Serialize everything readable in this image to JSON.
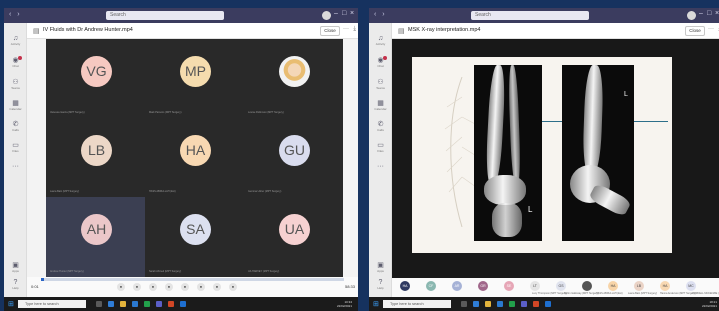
{
  "common": {
    "search_placeholder": "Search",
    "nav_arrows": "‹ ›",
    "window_controls": {
      "more": "···",
      "minimize": "–",
      "restore": "□",
      "close": "×"
    },
    "rail": [
      {
        "icon": "activity-icon",
        "label": "Activity"
      },
      {
        "icon": "chat-icon",
        "label": "Chat"
      },
      {
        "icon": "teams-icon",
        "label": "Teams"
      },
      {
        "icon": "calendar-icon",
        "label": "Calendar"
      },
      {
        "icon": "calls-icon",
        "label": "Calls"
      },
      {
        "icon": "files-icon",
        "label": "Files"
      }
    ],
    "rail_bottom": [
      {
        "label": "Apps"
      },
      {
        "label": "Help"
      }
    ],
    "close_label": "Close",
    "taskbar": {
      "search_placeholder": "Type here to search"
    },
    "colors": {
      "titlebar": "#3b3c5f",
      "accent": "#2a64c5",
      "taskbar": "#1b1b1b"
    }
  },
  "left": {
    "file_title": "IV Fluids with Dr Andrew Hunter.mp4",
    "tiles": [
      {
        "initials": "VG",
        "color": "#f6c9c1",
        "name": "Vanessa Garcia (MPT Surgery)"
      },
      {
        "initials": "MP",
        "color": "#f5dcae",
        "name": "Mark Parsons (MPT Surgery)"
      },
      {
        "initials": "",
        "photo": true,
        "name": "Louise Robinson (MPT Surgery)"
      },
      {
        "initials": "LB",
        "color": "#ecd7c7",
        "name": "Laura Bain (MPT Surgery)"
      },
      {
        "initials": "HA",
        "color": "#f8d8b2",
        "name": "HASS ABDULLAH (Ext)"
      },
      {
        "initials": "GU",
        "color": "#d9dcee",
        "name": "Gemma Usher (MPT Surgery)"
      },
      {
        "initials": "AH",
        "color": "#ebc7c9",
        "name": "Andrew Hunter (MPT Surgery)",
        "selected": true
      },
      {
        "initials": "SA",
        "color": "#dce0f0",
        "name": "Sarah Ahmed (MPT Surgery)"
      },
      {
        "initials": "UA",
        "color": "#f6d1d1",
        "name": "UA HARVEY (MPT Surgery)"
      }
    ],
    "playback": {
      "current": "0:01",
      "total": "58:33",
      "progress": 0.01
    },
    "controls": [
      "Play",
      "Back",
      "Fwd",
      "Vol",
      "Captions",
      "Speed",
      "Settings",
      "Full"
    ],
    "clock": {
      "time": "10:34",
      "date": "22/02/2021"
    }
  },
  "right": {
    "file_title": "MSK X-ray interpretation.mp4",
    "xray_marker": "L",
    "participants": [
      {
        "initials": "HA",
        "color": "#2f3a61",
        "text": "#fff"
      },
      {
        "initials": "CF",
        "color": "#8ab7b0",
        "text": "#fff"
      },
      {
        "initials": "AR",
        "color": "#a6b2d6",
        "text": "#fff"
      },
      {
        "initials": "GR",
        "color": "#a0678a",
        "text": "#fff"
      },
      {
        "initials": "SE",
        "color": "#e6a6b6",
        "text": "#fff"
      },
      {
        "initials": "LT",
        "color": "#e5e5e5",
        "text": "#444"
      },
      {
        "initials": "GS",
        "color": "#e0e3ee",
        "text": "#444"
      },
      {
        "initials": "",
        "color": "#555555",
        "text": "#fff"
      },
      {
        "initials": "HA",
        "color": "#f7d4a8",
        "text": "#444"
      },
      {
        "initials": "LB",
        "color": "#ead3c6",
        "text": "#444"
      },
      {
        "initials": "HA",
        "color": "#f8d8b2",
        "text": "#444"
      },
      {
        "initials": "MC",
        "color": "#dcdff0",
        "text": "#444"
      }
    ],
    "participant_captions": [
      "Lucy Thompson (MPT Surgery)",
      "Rubin Galloway (MPT Surgery)",
      "HASS ABDULLAH (Ext)",
      "Laura Bain (MPT Surgery)",
      "Hanna Anderson (MPT Surgery)",
      "CORNELL MCKENZIE (MPT Surgery)"
    ],
    "clock": {
      "time": "18:21",
      "date": "22/02/2021"
    }
  }
}
